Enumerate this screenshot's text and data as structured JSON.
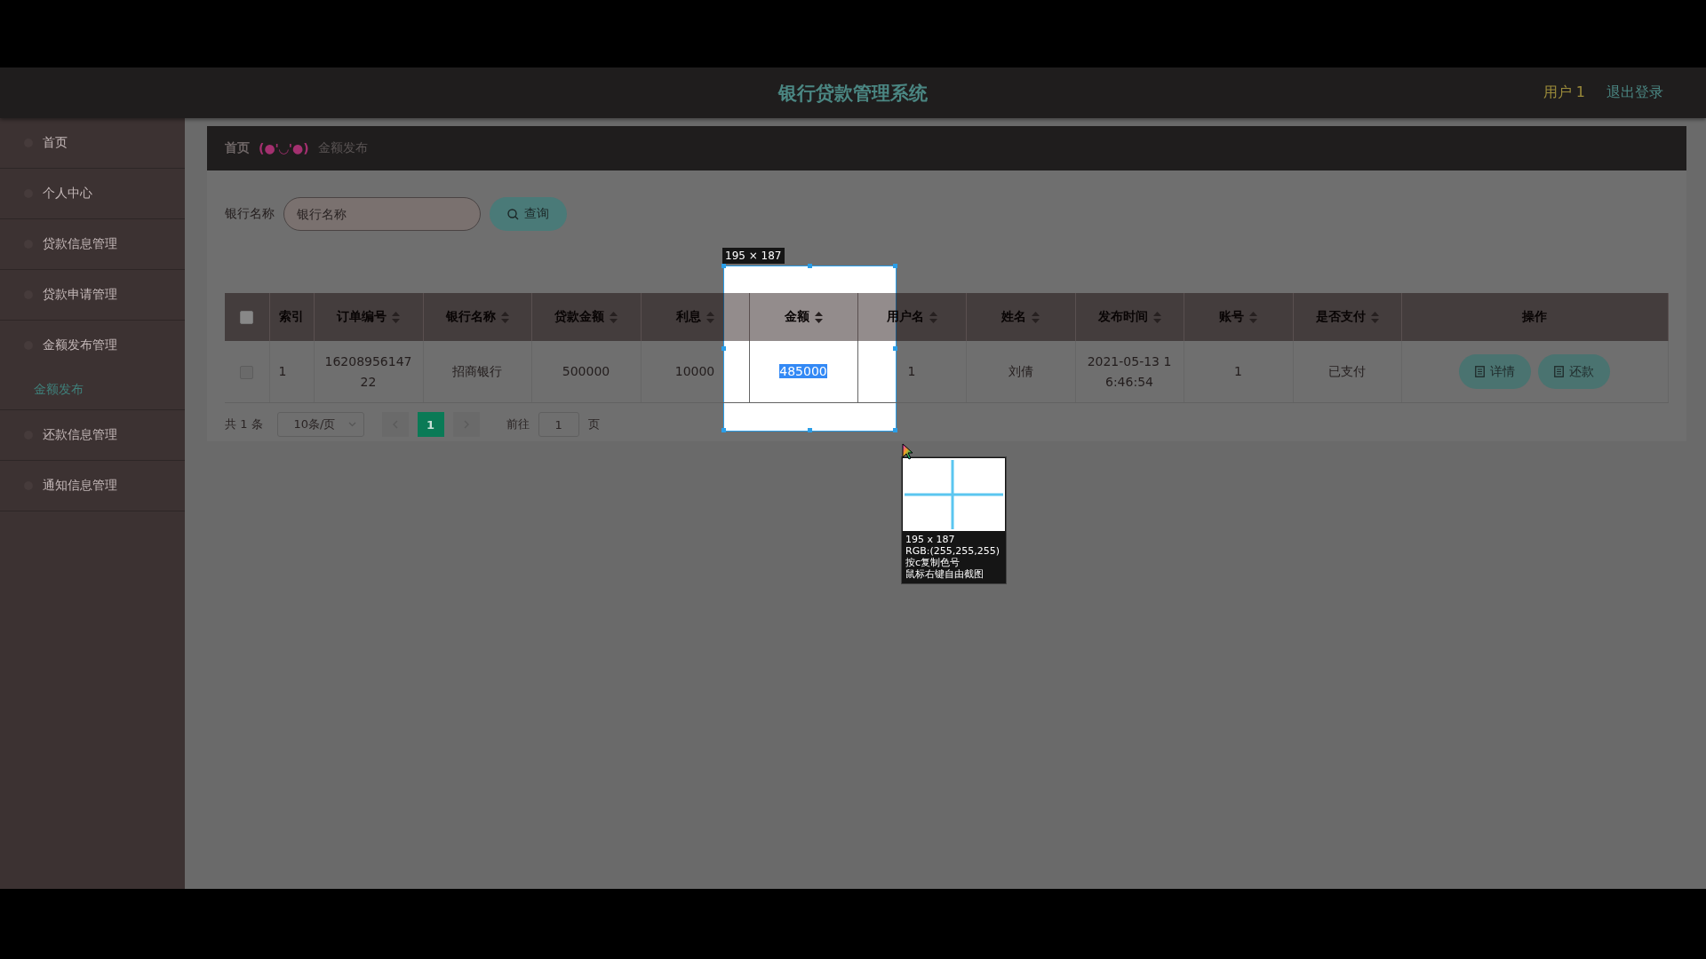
{
  "header": {
    "title": "银行贷款管理系统",
    "user": "用户 1",
    "logout": "退出登录"
  },
  "sidebar": {
    "items": [
      {
        "label": "首页"
      },
      {
        "label": "个人中心"
      },
      {
        "label": "贷款信息管理"
      },
      {
        "label": "贷款申请管理"
      },
      {
        "label": "金额发布管理",
        "children": [
          {
            "label": "金额发布",
            "selected": true
          }
        ]
      },
      {
        "label": "还款信息管理"
      },
      {
        "label": "通知信息管理"
      }
    ]
  },
  "breadcrumb": {
    "home": "首页",
    "separator": "(●'◡'●)",
    "current": "金额发布"
  },
  "search": {
    "label": "银行名称",
    "placeholder": "银行名称",
    "button": "查询"
  },
  "table": {
    "select_all": {
      "checked": false
    },
    "columns": [
      {
        "label": "索引",
        "sortable": false
      },
      {
        "label": "订单编号",
        "sortable": true
      },
      {
        "label": "银行名称",
        "sortable": true
      },
      {
        "label": "贷款金额",
        "sortable": true
      },
      {
        "label": "利息",
        "sortable": true
      },
      {
        "label": "金额",
        "sortable": true
      },
      {
        "label": "用户名",
        "sortable": true
      },
      {
        "label": "姓名",
        "sortable": true
      },
      {
        "label": "发布时间",
        "sortable": true
      },
      {
        "label": "账号",
        "sortable": true
      },
      {
        "label": "是否支付",
        "sortable": true
      },
      {
        "label": "操作",
        "sortable": false
      }
    ],
    "rows": [
      {
        "checked": false,
        "cells": [
          {
            "text": "1",
            "selected": false
          },
          {
            "text": "1620895614722",
            "selected": false
          },
          {
            "text": "招商银行",
            "selected": false
          },
          {
            "text": "500000",
            "selected": false
          },
          {
            "text": "10000",
            "selected": false
          },
          {
            "text": "485000",
            "selected": true
          },
          {
            "text": "1",
            "selected": false
          },
          {
            "text": "刘倩",
            "selected": false
          },
          {
            "text": "2021-05-13 16:46:54",
            "selected": false
          },
          {
            "text": "1",
            "selected": false
          },
          {
            "text": "已支付",
            "selected": false
          }
        ],
        "actions": [
          "详情",
          "还款"
        ]
      }
    ]
  },
  "pagination": {
    "total": "共 1 条",
    "page_size": "10条/页",
    "pages": [
      {
        "label": "1",
        "selected": true
      }
    ],
    "goto_label": "前往",
    "goto_value": "1",
    "page_suffix": "页"
  },
  "capture_overlay": {
    "size_label": "195 × 187",
    "info_lines": [
      "195 x 187",
      "RGB:(255,255,255)",
      "按c复制色号",
      "鼠标右键自由截图"
    ]
  }
}
